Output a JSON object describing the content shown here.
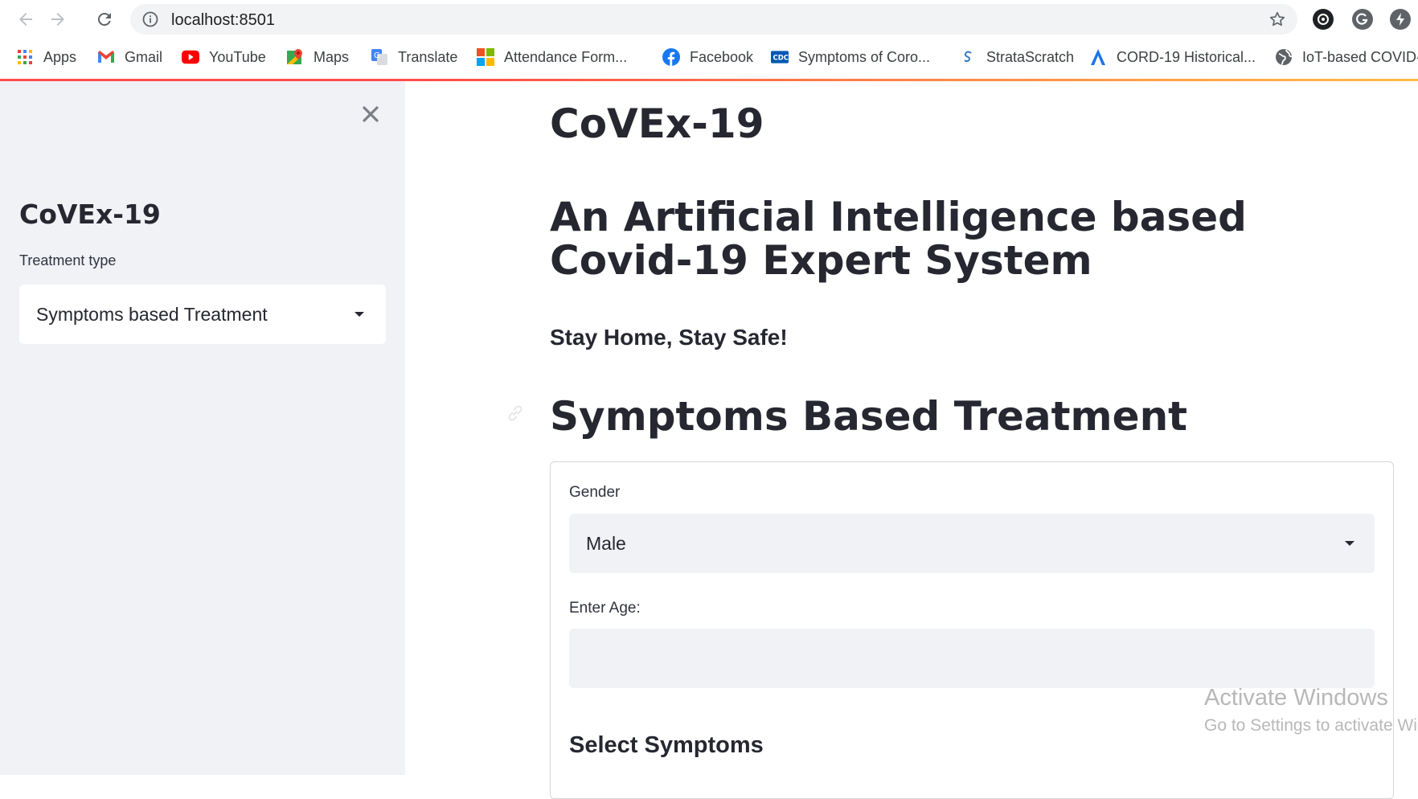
{
  "browser": {
    "url": "localhost:8501",
    "bookmarks": [
      {
        "label": "Apps",
        "icon": "apps-grid-icon"
      },
      {
        "label": "Gmail",
        "icon": "gmail-icon"
      },
      {
        "label": "YouTube",
        "icon": "youtube-icon"
      },
      {
        "label": "Maps",
        "icon": "maps-icon"
      },
      {
        "label": "Translate",
        "icon": "translate-icon"
      },
      {
        "label": "Attendance Form...",
        "icon": "microsoft-icon"
      },
      {
        "label": "Facebook",
        "icon": "facebook-icon"
      },
      {
        "label": "Symptoms of Coro...",
        "icon": "cdc-icon"
      },
      {
        "label": "StrataScratch",
        "icon": "stratascratch-icon"
      },
      {
        "label": "CORD-19 Historical...",
        "icon": "cord19-icon"
      },
      {
        "label": "IoT-based COVID-",
        "icon": "globe-icon"
      }
    ]
  },
  "sidebar": {
    "title": "CoVEx-19",
    "treatment_label": "Treatment type",
    "treatment_value": "Symptoms based Treatment"
  },
  "main": {
    "app_title": "CoVEx-19",
    "subtitle": "An Artificial Intelligence based Covid-19 Expert System",
    "tagline": "Stay Home, Stay Safe!",
    "section_title": "Symptoms Based Treatment",
    "form": {
      "gender_label": "Gender",
      "gender_value": "Male",
      "age_label": "Enter Age:",
      "age_value": "",
      "symptoms_heading": "Select Symptoms"
    }
  },
  "os_watermark": {
    "line1": "Activate Windows",
    "line2": "Go to Settings to activate Windows."
  },
  "colors": {
    "accent": "#ff4b4b",
    "sidebar_bg": "#f0f2f6",
    "text": "#262730"
  }
}
